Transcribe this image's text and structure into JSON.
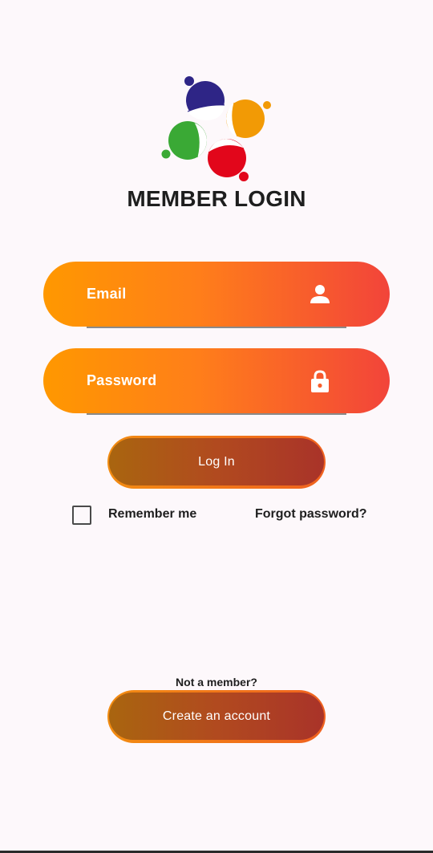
{
  "colors": {
    "background": "#fdf8fb",
    "field_gradient_start": "#ff9800",
    "field_gradient_end": "#f2443a",
    "button_gradient_start": "#a9650f",
    "button_gradient_end": "#a93329",
    "text": "#1e1e1e",
    "logo_blue": "#2e2586",
    "logo_orange": "#f29a05",
    "logo_green": "#3aa935",
    "logo_red": "#e2061b"
  },
  "header": {
    "logo_icon": "bubbles-logo",
    "title": "MEMBER LOGIN"
  },
  "form": {
    "email": {
      "label": "Email",
      "icon": "person-icon"
    },
    "password": {
      "label": "Password",
      "icon": "lock-icon"
    },
    "login_button": "Log In",
    "remember_me": {
      "label": "Remember me",
      "checked": false
    },
    "forgot_password": "Forgot password?"
  },
  "signup": {
    "prompt": "Not a member?",
    "create_button": "Create an account"
  }
}
